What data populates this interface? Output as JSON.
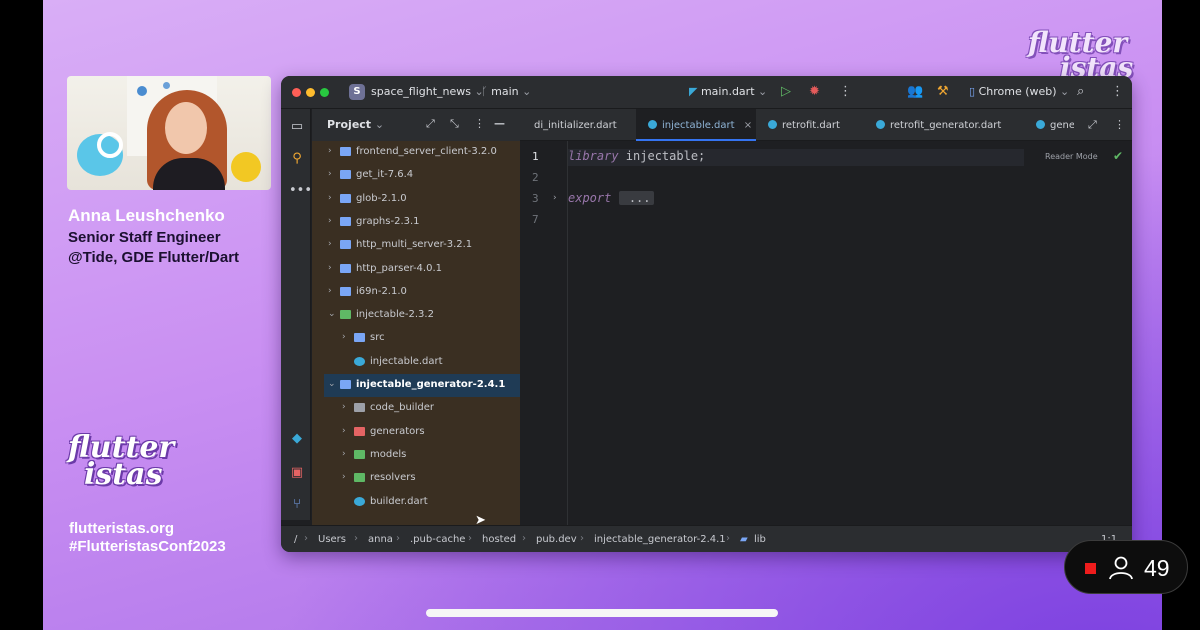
{
  "speaker": {
    "name": "Anna Leushchenko",
    "role": "Senior Staff Engineer",
    "org": "@Tide, GDE Flutter/Dart"
  },
  "brand": {
    "logo_top": "flutter",
    "logo_bottom": "istas",
    "site": "flutteristas.org",
    "hashtag": "#FlutteristasConf2023"
  },
  "viewers": {
    "count": "49"
  },
  "ide": {
    "project_badge": "S",
    "project_name": "space_flight_news",
    "branch": "main",
    "run_config": "main.dart",
    "device": "Chrome (web)",
    "project_panel": {
      "title": "Project",
      "tree": [
        {
          "label": "frontend_server_client-3.2.0",
          "level": 1,
          "expanded": false,
          "kind": "folder"
        },
        {
          "label": "get_it-7.6.4",
          "level": 1,
          "expanded": false,
          "kind": "folder"
        },
        {
          "label": "glob-2.1.0",
          "level": 1,
          "expanded": false,
          "kind": "folder"
        },
        {
          "label": "graphs-2.3.1",
          "level": 1,
          "expanded": false,
          "kind": "folder"
        },
        {
          "label": "http_multi_server-3.2.1",
          "level": 1,
          "expanded": false,
          "kind": "folder"
        },
        {
          "label": "http_parser-4.0.1",
          "level": 1,
          "expanded": false,
          "kind": "folder"
        },
        {
          "label": "i69n-2.1.0",
          "level": 1,
          "expanded": false,
          "kind": "folder"
        },
        {
          "label": "injectable-2.3.2",
          "level": 1,
          "expanded": true,
          "kind": "folder-green"
        },
        {
          "label": "src",
          "level": 2,
          "expanded": false,
          "kind": "folder-src"
        },
        {
          "label": "injectable.dart",
          "level": 2,
          "expanded": false,
          "kind": "dart"
        },
        {
          "label": "injectable_generator-2.4.1",
          "level": 1,
          "expanded": true,
          "kind": "folder",
          "selected": true
        },
        {
          "label": "code_builder",
          "level": 2,
          "expanded": false,
          "kind": "folder-gray"
        },
        {
          "label": "generators",
          "level": 2,
          "expanded": false,
          "kind": "folder-red"
        },
        {
          "label": "models",
          "level": 2,
          "expanded": false,
          "kind": "folder-green"
        },
        {
          "label": "resolvers",
          "level": 2,
          "expanded": false,
          "kind": "folder-green"
        },
        {
          "label": "builder.dart",
          "level": 2,
          "expanded": false,
          "kind": "dart"
        }
      ]
    },
    "tabs": [
      {
        "label": "di_initializer.dart",
        "active": false
      },
      {
        "label": "injectable.dart",
        "active": true
      },
      {
        "label": "retrofit.dart",
        "active": false
      },
      {
        "label": "retrofit_generator.dart",
        "active": false
      },
      {
        "label": "gene",
        "active": false
      }
    ],
    "editor": {
      "lines": [
        {
          "num": "1",
          "keyword": "library",
          "rest": " injectable;"
        },
        {
          "num": "2",
          "keyword": "",
          "rest": ""
        },
        {
          "num": "3",
          "keyword": "export",
          "rest": " ..."
        },
        {
          "num": "7",
          "keyword": "",
          "rest": ""
        }
      ],
      "reader_mode": "Reader Mode"
    },
    "breadcrumb": [
      "/",
      "Users",
      "anna",
      ".pub-cache",
      "hosted",
      "pub.dev",
      "injectable_generator-2.4.1",
      "lib"
    ],
    "status_right": "1:1"
  },
  "colors": {
    "accent": "#3574f0",
    "dart_blue": "#3aa9d8",
    "folder_blue": "#7aa6f5",
    "record_red": "#ee1c1c"
  }
}
